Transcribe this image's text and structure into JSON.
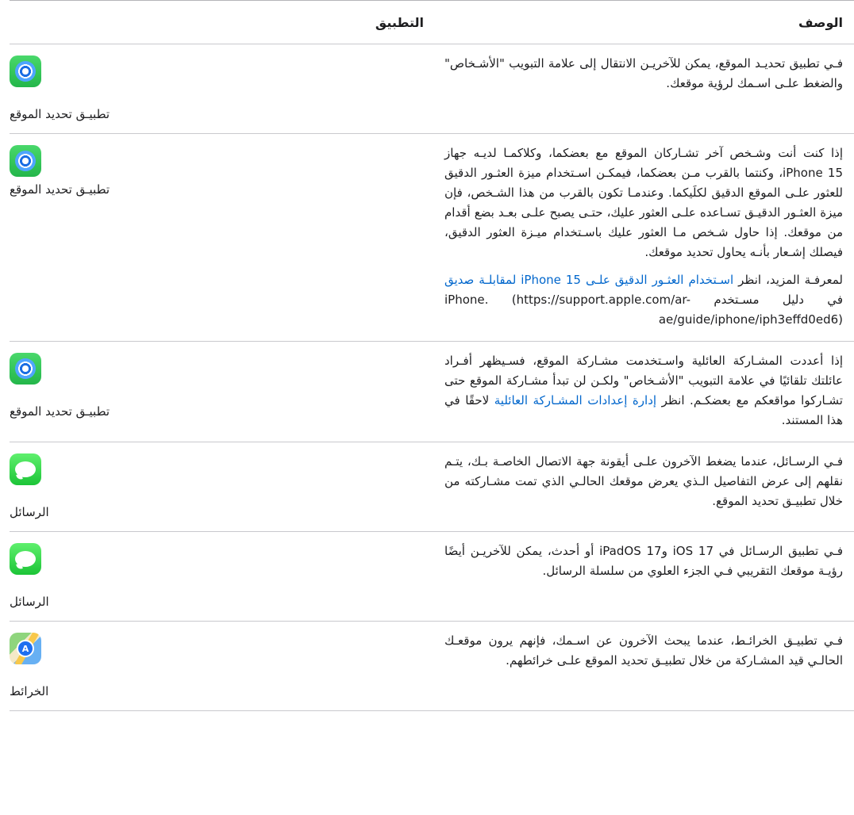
{
  "header": {
    "description": "الوصف",
    "app": "التطبيق"
  },
  "rows": [
    {
      "paragraphs": [
        "فـي تطبيق تحديـد الموقع، يمكن للآخريـن الانتقال إلى علامة التبويب \"الأشـخاص\" والضغط علـى اسـمك لرؤية موقعك."
      ],
      "app_name": "تطبيـق تحديد الموقع",
      "icon": "find-my-icon"
    },
    {
      "paragraphs": [
        "إذا كنت أنت وشـخص آخر تشـاركان الموقع مع بعضكما، وكلاكمـا لديـه جهاز iPhone 15، وكنتما بالقرب مـن بعضكما، فيمكـن اسـتخدام ميزة العثـور الدقيق للعثور علـى الموقع الدقيق لكلَيكما. وعندمـا تكون بالقرب من هذا الشـخص، فإن ميزة العثـور الدقيـق تسـاعده علـى العثور عليك، حتـى يصبح علـى بعـد بضع أقدام من موقعك. إذا حاول شـخص مـا العثور عليك باسـتخدام ميـزة العثور الدقيق، فيصلك إشـعار بأنـه يحاول تحديد موقعك."
      ],
      "more_prefix": "لمعرفـة المزيد، انظر",
      "more_link": "اسـتخدام العثـور الدقيق علـى iPhone 15 لمقابلـة صديق",
      "more_suffix": "في دليل مسـتخدم iPhone.",
      "more_url": "(https://support.apple.com/ar-ae/guide/iphone/iph3effd0ed6)",
      "app_name": "تطبيـق تحديد الموقع",
      "icon": "find-my-icon"
    },
    {
      "paragraphs": [],
      "p3_text": "إذا أعددت المشـاركة العائلية واسـتخدمت مشـاركة الموقع، فسـيظهر أفـراد عائلتك تلقائيًا في علامة التبويب \"الأشـخاص\" ولكـن لن تبدأ مشـاركة الموقع حتى تشـاركوا مواقعكم مع بعضكـم. انظر",
      "p3_link": "إدارة إعدادات المشـاركة العائلية",
      "p3_suffix": "لاحقًا في هذا المستند.",
      "app_name": "تطبيـق تحديد الموقع",
      "icon": "find-my-icon"
    },
    {
      "paragraphs": [
        "فـي الرسـائل، عندما يضغط الآخرون علـى أيقونة جهة الاتصال الخاصـة بـك، يتـم نقلهم إلى عرض التفاصيل الـذي يعرض موقعك الحالـي الذي تمت مشـاركته من خلال تطبيـق تحديد الموقع."
      ],
      "app_name": "الرسائل",
      "icon": "messages-icon"
    },
    {
      "paragraphs": [
        "فـي تطبيق الرسـائل في iOS 17 وiPadOS 17 أو أحدث، يمكن للآخريـن أيضًا رؤيـة موقعك التقريبي فـي الجزء العلوي من سلسلة الرسائل."
      ],
      "app_name": "الرسائل",
      "icon": "messages-icon"
    },
    {
      "paragraphs": [
        "فـي تطبيـق الخرائـط، عندما يبحث الآخرون عن اسـمك، فإنهم يرون موقعـك الحالـي قيد المشـاركة من خلال تطبيـق تحديد الموقع علـى خرائطهم."
      ],
      "app_name": "الخرائط",
      "icon": "maps-icon"
    }
  ]
}
